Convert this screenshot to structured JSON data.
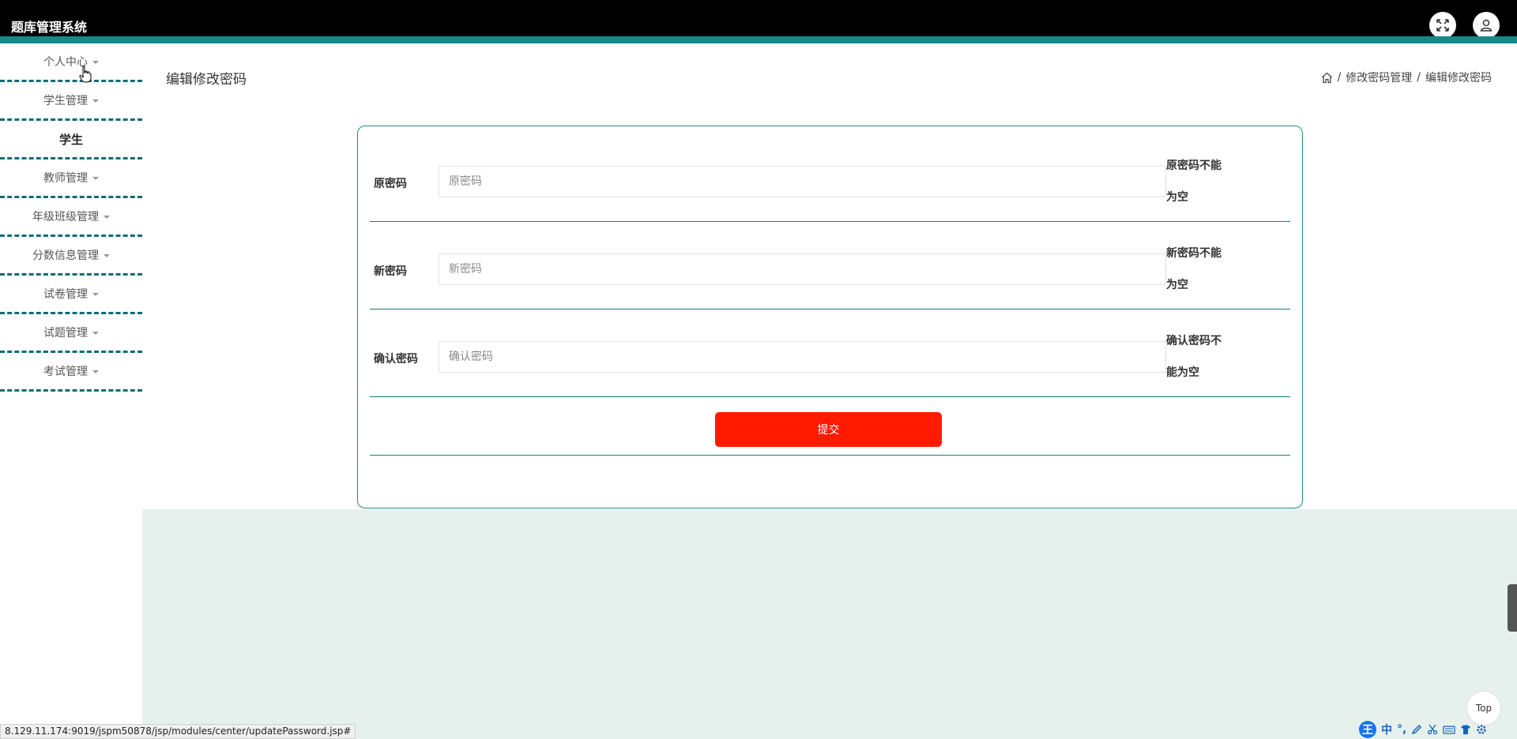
{
  "header": {
    "app_title": "题库管理系统",
    "icons": [
      "fullscreen-icon",
      "user-icon"
    ]
  },
  "sidebar": {
    "items": [
      {
        "label": "个人中心",
        "has_caret": true
      },
      {
        "label": "学生管理",
        "has_caret": true
      },
      {
        "label": "学生",
        "has_caret": false,
        "active": true
      },
      {
        "label": "教师管理",
        "has_caret": true
      },
      {
        "label": "年级班级管理",
        "has_caret": true
      },
      {
        "label": "分数信息管理",
        "has_caret": true
      },
      {
        "label": "试卷管理",
        "has_caret": true
      },
      {
        "label": "试题管理",
        "has_caret": true
      },
      {
        "label": "考试管理",
        "has_caret": true
      }
    ]
  },
  "page": {
    "title": "编辑修改密码",
    "breadcrumb": [
      "修改密码管理",
      "编辑修改密码"
    ]
  },
  "form": {
    "fields": [
      {
        "label": "原密码",
        "placeholder": "原密码",
        "error": "原密码不能为空"
      },
      {
        "label": "新密码",
        "placeholder": "新密码",
        "error": "新密码不能为空"
      },
      {
        "label": "确认密码",
        "placeholder": "确认密码",
        "error": "确认密码不能为空"
      }
    ],
    "submit_label": "提交"
  },
  "status_url": "8.129.11.174:9019/jspm50878/jsp/modules/center/updatePassword.jsp#",
  "top_button": "Top",
  "ime": {
    "logo": "王",
    "mode": "中",
    "punct": "°,"
  },
  "colors": {
    "accent": "#168a8a",
    "submit": "#ff1a00",
    "panel_bg": "#e6f0ec",
    "header_bg": "#000000"
  }
}
